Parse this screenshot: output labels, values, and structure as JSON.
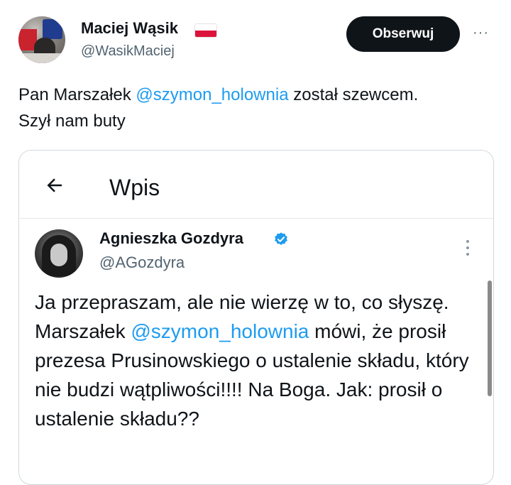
{
  "post": {
    "author_name": "Maciej Wąsik",
    "author_handle": "@WasikMaciej",
    "follow_label": "Obserwuj",
    "more_label": "···",
    "text_before_mention": "Pan Marszałek ",
    "mention": "@szymon_holownia",
    "text_after_mention": " został szewcem.",
    "text_line2": "Szył nam buty"
  },
  "quoted": {
    "header_title": "Wpis",
    "author_name": "Agnieszka Gozdyra",
    "author_handle": "@AGozdyra",
    "text_part1": "Ja przepraszam, ale nie wierzę w to, co słyszę. Marszałek ",
    "mention": "@szymon_holownia",
    "text_part2": " mówi, że prosił prezesa Prusinowskiego o ustalenie składu, który nie budzi wątpliwości!!!! Na Boga. Jak: prosił o ustalenie składu??"
  },
  "colors": {
    "mention": "#1d9bf0",
    "follow_button_bg": "#0f1419",
    "verified_badge": "#1d9bf0",
    "polish_flag_red": "#dc143c"
  },
  "icons": {
    "back": "arrow-left-icon",
    "more": "more-horizontal-icon",
    "verified": "verified-badge-icon",
    "flag": "poland-flag-icon"
  }
}
